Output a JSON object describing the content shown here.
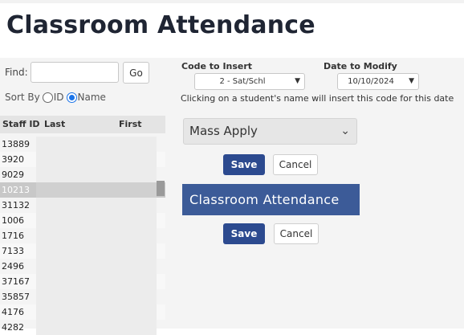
{
  "page": {
    "title": "Classroom Attendance"
  },
  "find": {
    "label": "Find:",
    "value": "",
    "go_label": "Go"
  },
  "sort": {
    "label": "Sort By",
    "options": [
      "ID",
      "Name"
    ],
    "selected": "Name"
  },
  "table": {
    "headers": [
      "Staff ID",
      "Last",
      "First"
    ],
    "rows": [
      {
        "id": "13889"
      },
      {
        "id": "3920"
      },
      {
        "id": "9029"
      },
      {
        "id": "10213",
        "selected": true
      },
      {
        "id": "31132"
      },
      {
        "id": "1006"
      },
      {
        "id": "1716"
      },
      {
        "id": "7133"
      },
      {
        "id": "2496"
      },
      {
        "id": "37167"
      },
      {
        "id": "35857"
      },
      {
        "id": "4176"
      },
      {
        "id": "4282"
      }
    ]
  },
  "code_to_insert": {
    "label": "Code to Insert",
    "value": "2 - Sat/Schl"
  },
  "date_to_modify": {
    "label": "Date to Modify",
    "value": "10/10/2024"
  },
  "help_text": "Clicking on a student's name will insert this code for this date",
  "mass_apply": {
    "label": "Mass Apply"
  },
  "buttons": {
    "save": "Save",
    "cancel": "Cancel"
  },
  "banner": {
    "title": "Classroom Attendance"
  }
}
